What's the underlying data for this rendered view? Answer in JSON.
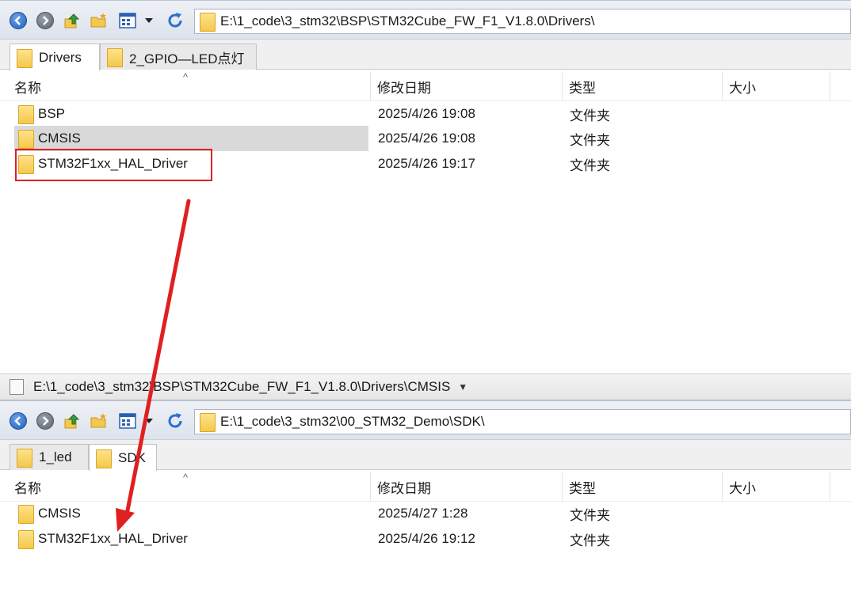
{
  "top": {
    "address": "E:\\1_code\\3_stm32\\BSP\\STM32Cube_FW_F1_V1.8.0\\Drivers\\",
    "tabs": [
      "Drivers",
      "2_GPIO—LED点灯"
    ],
    "columns": [
      "名称",
      "修改日期",
      "类型",
      "大小"
    ],
    "rows": [
      {
        "name": "BSP",
        "date": "2025/4/26 19:08",
        "type": "文件夹"
      },
      {
        "name": "CMSIS",
        "date": "2025/4/26 19:08",
        "type": "文件夹"
      },
      {
        "name": "STM32F1xx_HAL_Driver",
        "date": "2025/4/26 19:17",
        "type": "文件夹"
      }
    ],
    "status": "E:\\1_code\\3_stm32\\BSP\\STM32Cube_FW_F1_V1.8.0\\Drivers\\CMSIS"
  },
  "bottom": {
    "address": "E:\\1_code\\3_stm32\\00_STM32_Demo\\SDK\\",
    "tabs": [
      "1_led",
      "SDK"
    ],
    "columns": [
      "名称",
      "修改日期",
      "类型",
      "大小"
    ],
    "rows": [
      {
        "name": "CMSIS",
        "date": "2025/4/27 1:28",
        "type": "文件夹"
      },
      {
        "name": "STM32F1xx_HAL_Driver",
        "date": "2025/4/26 19:12",
        "type": "文件夹"
      }
    ]
  },
  "colors": {
    "annotation": "#e02020",
    "selection": "#d9d9d9"
  },
  "icons": [
    "back-icon",
    "forward-icon",
    "up-icon",
    "new-folder-icon",
    "view-icon",
    "dropdown-icon",
    "refresh-icon",
    "folder-icon"
  ]
}
